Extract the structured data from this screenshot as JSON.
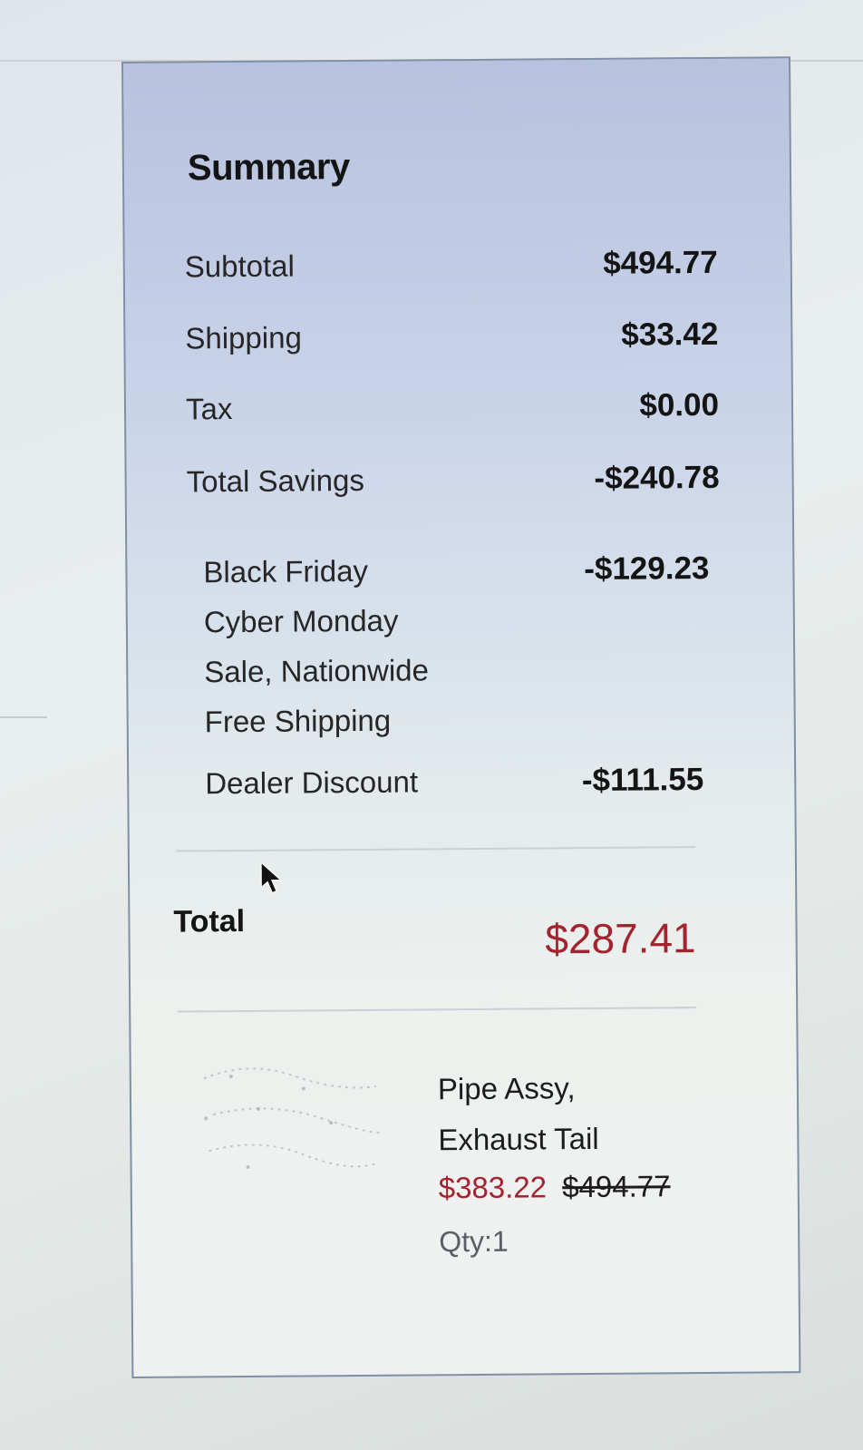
{
  "summary": {
    "title": "Summary",
    "rows": [
      {
        "label": "Subtotal",
        "value": "$494.77"
      },
      {
        "label": "Shipping",
        "value": "$33.42"
      },
      {
        "label": "Tax",
        "value": "$0.00"
      },
      {
        "label": "Total Savings",
        "value": "-$240.78"
      }
    ],
    "savings_breakdown": {
      "promo_lines": [
        "Black Friday",
        "Cyber Monday",
        "Sale, Nationwide",
        "Free Shipping"
      ],
      "promo_value": "-$129.23",
      "dealer_label": "Dealer Discount",
      "dealer_value": "-$111.55"
    },
    "total": {
      "label": "Total",
      "value": "$287.41"
    }
  },
  "product": {
    "name_line1": "Pipe Assy,",
    "name_line2": "Exhaust Tail",
    "sale_price": "$383.22",
    "original_price": "$494.77",
    "qty": "Qty:1"
  },
  "colors": {
    "accent_red": "#a3242f",
    "panel_border": "#7f8fa6"
  },
  "icons": {
    "cursor": "mouse-pointer-icon",
    "product": "product-thumbnail"
  }
}
